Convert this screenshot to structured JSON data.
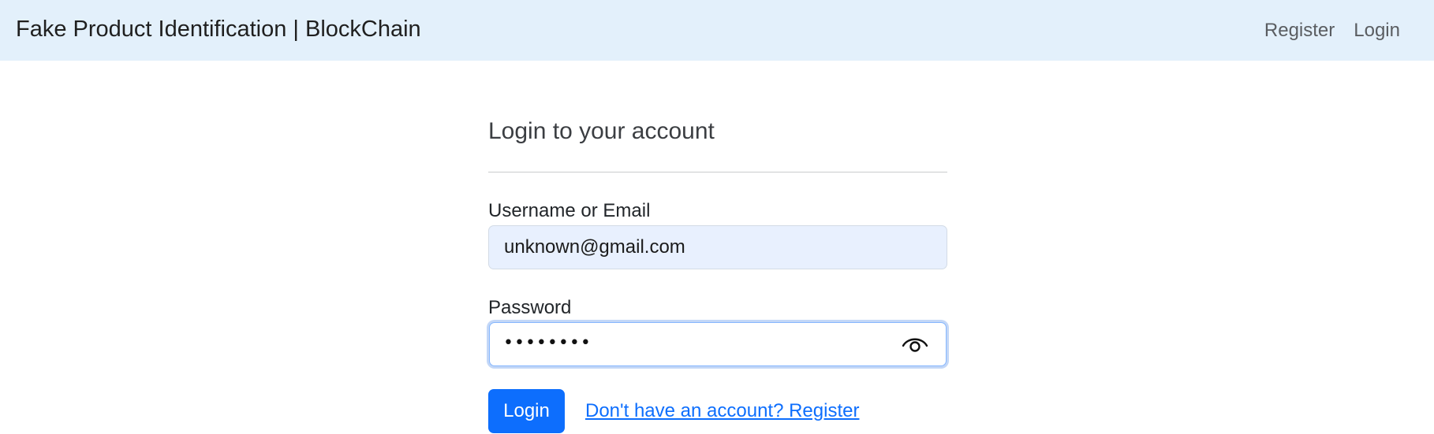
{
  "navbar": {
    "brand": "Fake Product Identification | BlockChain",
    "links": [
      {
        "label": "Register"
      },
      {
        "label": "Login"
      }
    ]
  },
  "form": {
    "heading": "Login to your account",
    "username_label": "Username or Email",
    "username_value": "unknown@gmail.com",
    "password_label": "Password",
    "password_masked": "••••••••",
    "password_toggle_icon": "eye-icon",
    "submit_label": "Login",
    "register_link": "Don't have an account? Register"
  },
  "colors": {
    "navbar_bg": "#e3f0fb",
    "primary": "#0d6efd",
    "autofill_bg": "#e8f0fe",
    "focus_ring": "#c3d7f7"
  }
}
